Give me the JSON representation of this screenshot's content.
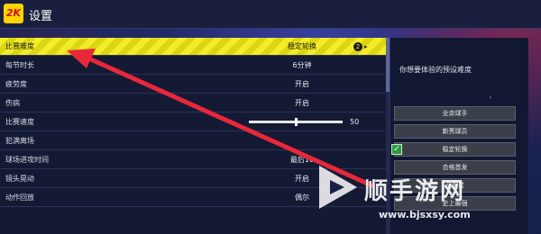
{
  "header": {
    "title": "设置",
    "logo": "2K"
  },
  "settings": {
    "rows": [
      {
        "label": "比赛难度",
        "value": "稳定轮换"
      },
      {
        "label": "每节时长",
        "value": "6分钟"
      },
      {
        "label": "疲劳度",
        "value": "开启"
      },
      {
        "label": "伤病",
        "value": "开启"
      },
      {
        "label": "比赛速度",
        "value": "",
        "slider_value": "50",
        "slider_fraction": 0.5
      },
      {
        "label": "犯满离场",
        "value": ""
      },
      {
        "label": "球场进攻时间",
        "value": "最后10"
      },
      {
        "label": "镜头晃动",
        "value": "开启"
      },
      {
        "label": "动作回放",
        "value": "偶尔"
      }
    ],
    "selected_badge": "2"
  },
  "side": {
    "description": "你想要体验的预设难度",
    "dot": "。",
    "options": [
      {
        "label": "业余球手"
      },
      {
        "label": "新秀球员"
      },
      {
        "label": "稳定轮换",
        "checked": true
      },
      {
        "label": "合格首发"
      },
      {
        "label": "全明星"
      },
      {
        "label": "史上最强"
      }
    ]
  },
  "watermark": {
    "text": "顺手游网",
    "url": "www.bjsxsy.com"
  },
  "colors": {
    "highlight": "#f2ec2a",
    "arrow": "#e8283a",
    "check": "#2e9a3e"
  }
}
